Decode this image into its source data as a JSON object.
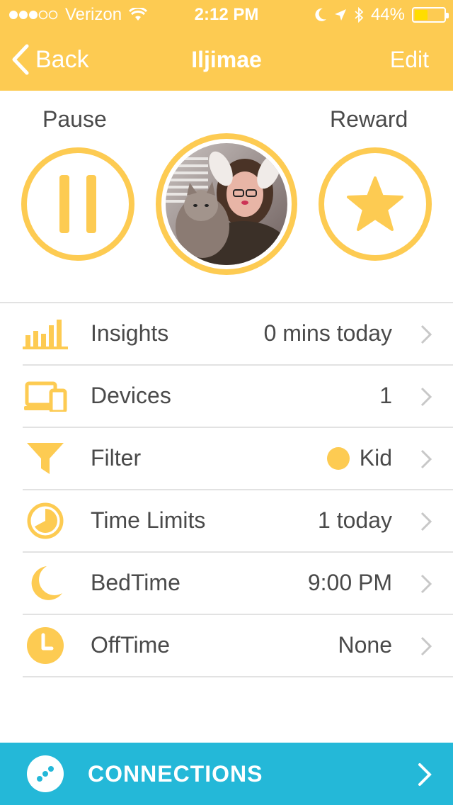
{
  "status_bar": {
    "carrier": "Verizon",
    "time": "2:12 PM",
    "battery": "44%",
    "battery_level": 0.44
  },
  "nav": {
    "back_label": "Back",
    "title": "Iljimae",
    "edit_label": "Edit"
  },
  "actions": {
    "pause_label": "Pause",
    "reward_label": "Reward"
  },
  "rows": [
    {
      "label": "Insights",
      "value": "0 mins today",
      "icon": "bar-chart-icon"
    },
    {
      "label": "Devices",
      "value": "1",
      "icon": "devices-icon"
    },
    {
      "label": "Filter",
      "value": "Kid",
      "icon": "filter-funnel-icon"
    },
    {
      "label": "Time Limits",
      "value": "1 today",
      "icon": "pie-timer-icon"
    },
    {
      "label": "BedTime",
      "value": "9:00 PM",
      "icon": "moon-icon"
    },
    {
      "label": "OffTime",
      "value": "None",
      "icon": "clock-icon"
    }
  ],
  "connections": {
    "label": "CONNECTIONS"
  },
  "colors": {
    "accent": "#fdcb52",
    "connections_bar": "#24b8d8",
    "text": "#4a4a4a",
    "divider": "#e2e2e2"
  }
}
